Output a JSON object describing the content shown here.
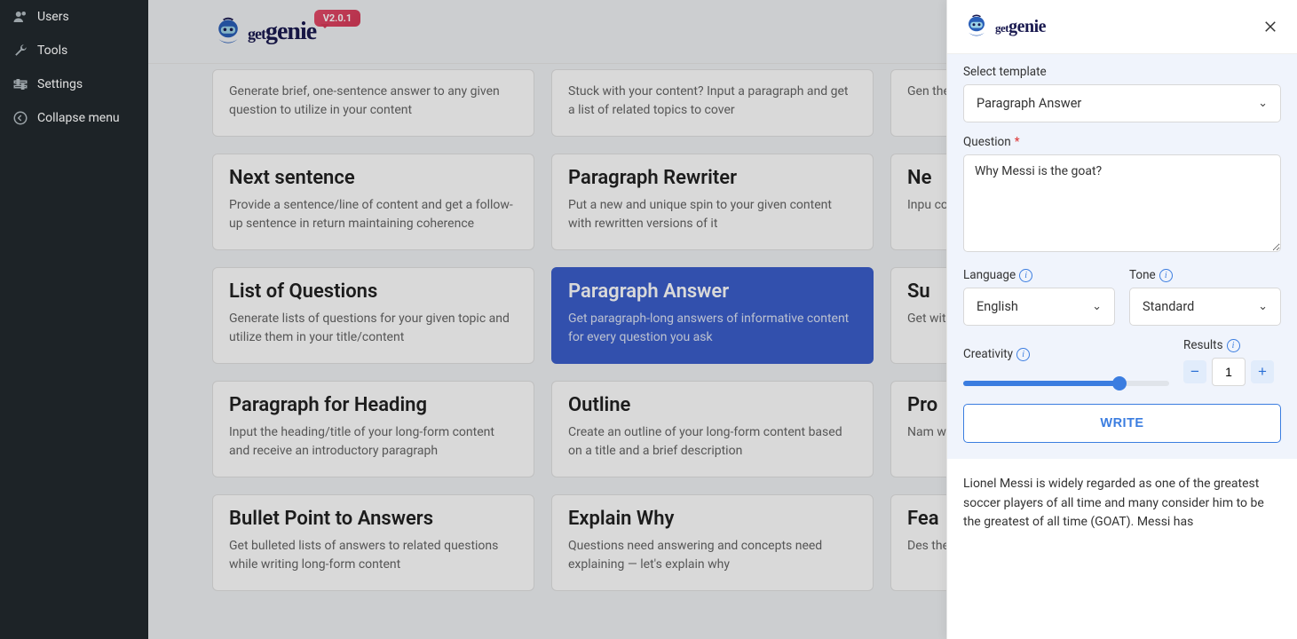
{
  "sidebar": {
    "items": [
      {
        "label": "Users",
        "icon": "users"
      },
      {
        "label": "Tools",
        "icon": "wrench"
      },
      {
        "label": "Settings",
        "icon": "settings"
      },
      {
        "label": "Collapse menu",
        "icon": "collapse"
      }
    ]
  },
  "header": {
    "brand": "genie",
    "version": "V2.0.1"
  },
  "cards": [
    [
      {
        "title": "",
        "desc": "Generate brief, one-sentence answer to any given question to utilize in your content"
      },
      {
        "title": "",
        "desc": "Stuck with your content? Input a paragraph and get a list of related topics to cover"
      },
      {
        "title": "",
        "desc": "Gen the"
      }
    ],
    [
      {
        "title": "Next sentence",
        "desc": "Provide a sentence/line of content and get a follow-up sentence in return maintaining coherence"
      },
      {
        "title": "Paragraph Rewriter",
        "desc": "Put a new and unique spin to your given content with rewritten versions of it"
      },
      {
        "title": "Ne",
        "desc": "Inpu cont"
      }
    ],
    [
      {
        "title": "List of Questions",
        "desc": "Generate lists of questions for your given topic and utilize them in your title/content"
      },
      {
        "title": "Paragraph Answer",
        "desc": "Get paragraph-long answers of informative content for every question you ask",
        "active": true
      },
      {
        "title": "Su",
        "desc": "Get with"
      }
    ],
    [
      {
        "title": "Paragraph for Heading",
        "desc": "Input the heading/title of your long-form content and receive an introductory paragraph"
      },
      {
        "title": "Outline",
        "desc": "Create an outline of your long-form content based on a title and a brief description"
      },
      {
        "title": "Pro",
        "desc": "Nam write"
      }
    ],
    [
      {
        "title": "Bullet Point to Answers",
        "desc": "Get bulleted lists of answers to related questions while writing long-form content"
      },
      {
        "title": "Explain Why",
        "desc": "Questions need answering and concepts need explaining — let's explain why"
      },
      {
        "title": "Fea",
        "desc": "Des the"
      }
    ]
  ],
  "panel": {
    "brand": "genie",
    "select_template_label": "Select template",
    "template_value": "Paragraph Answer",
    "question_label": "Question",
    "question_value": "Why Messi is the goat?",
    "language_label": "Language",
    "language_value": "English",
    "tone_label": "Tone",
    "tone_value": "Standard",
    "creativity_label": "Creativity",
    "results_label": "Results",
    "results_value": "1",
    "write_label": "WRITE",
    "output": "Lionel Messi is widely regarded as one of the greatest soccer players of all time and many consider him to be the greatest of all time (GOAT). Messi has"
  }
}
